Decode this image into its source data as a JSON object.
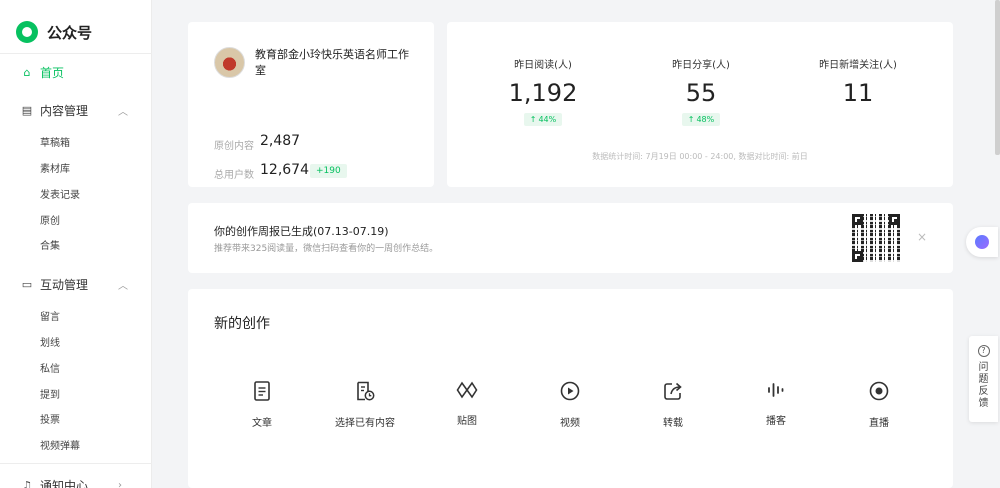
{
  "app": {
    "title": "公众号"
  },
  "sidebar": {
    "home": "首页",
    "content": {
      "label": "内容管理",
      "items": [
        "草稿箱",
        "素材库",
        "发表记录",
        "原创",
        "合集"
      ]
    },
    "interaction": {
      "label": "互动管理",
      "items": [
        "留言",
        "划线",
        "私信",
        "提到",
        "投票",
        "视频弹幕"
      ]
    },
    "notifications": {
      "label": "通知中心"
    }
  },
  "account": {
    "name": "教育部金小玲快乐英语名师工作室",
    "originals_label": "原创内容",
    "originals_value": "2,487",
    "users_label": "总用户数",
    "users_value": "12,674",
    "users_delta": "+190"
  },
  "stats": {
    "metrics": [
      {
        "label": "昨日阅读(人)",
        "value": "1,192",
        "change": "44%"
      },
      {
        "label": "昨日分享(人)",
        "value": "55",
        "change": "48%"
      },
      {
        "label": "昨日新增关注(人)",
        "value": "11"
      }
    ],
    "note": "数据统计时间: 7月19日 00:00 - 24:00, 数据对比时间: 前日",
    "up_arrow": "↑"
  },
  "report": {
    "title": "你的创作周报已生成(07.13-07.19)",
    "subtitle": "推荐带来325阅读量，微信扫码查看你的一周创作总结。",
    "close": "×"
  },
  "create": {
    "title": "新的创作",
    "tools": [
      "文章",
      "选择已有内容",
      "贴图",
      "视频",
      "转载",
      "播客",
      "直播"
    ]
  },
  "feedback": {
    "label": "问题反馈",
    "icon": "?"
  }
}
